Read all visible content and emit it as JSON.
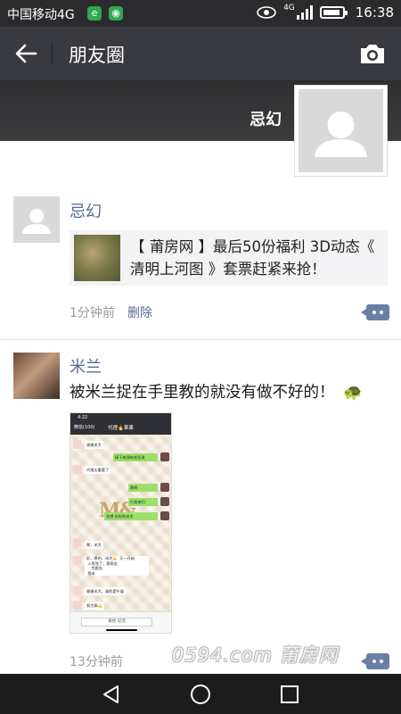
{
  "status_bar": {
    "carrier": "中国移动4G",
    "network": "4G",
    "time": "16:38",
    "battery_level": 0.9,
    "icons": [
      "e-app-icon",
      "wechat-bubble-icon",
      "eye-icon",
      "signal-icon",
      "battery-icon"
    ]
  },
  "header": {
    "title": "朋友圈",
    "back_icon": "back-arrow-icon",
    "camera_icon": "camera-icon"
  },
  "cover": {
    "user_name": "忌幻"
  },
  "posts": [
    {
      "author": "忌幻",
      "link_text": "【 莆房网 】最后50份福利 3D动态《 清明上河图 》套票赶紧来抢！",
      "time": "1分钟前",
      "delete_label": "删除"
    },
    {
      "author": "米兰",
      "text": "被米兰捉在手里教的就没有做不好的！",
      "emoji": "🐢",
      "time": "13分钟前",
      "image": {
        "status_time": "4:22",
        "chat_title": "代理🔥果果",
        "back_label": "微信(100)",
        "messages": [
          "谢谢米大",
          "接下来我有些话说",
          "代理太重要了",
          "嗯啊",
          "是吗",
          "打麦老们",
          "也想 好好的米大",
          "嗯，米大",
          "好，嗯的，米大💪  又一开始\n 入等完了，我帮去\n    为跟去\n 我米",
          "谢谢米大，真的是牛逼",
          "努力搞💪"
        ],
        "watermark": "M&",
        "input_label": "按住 说话"
      }
    }
  ],
  "watermark": "0594.com 莆房网",
  "nav": {
    "back_icon": "nav-back-icon",
    "home_icon": "nav-home-icon",
    "recent_icon": "nav-recent-icon"
  }
}
